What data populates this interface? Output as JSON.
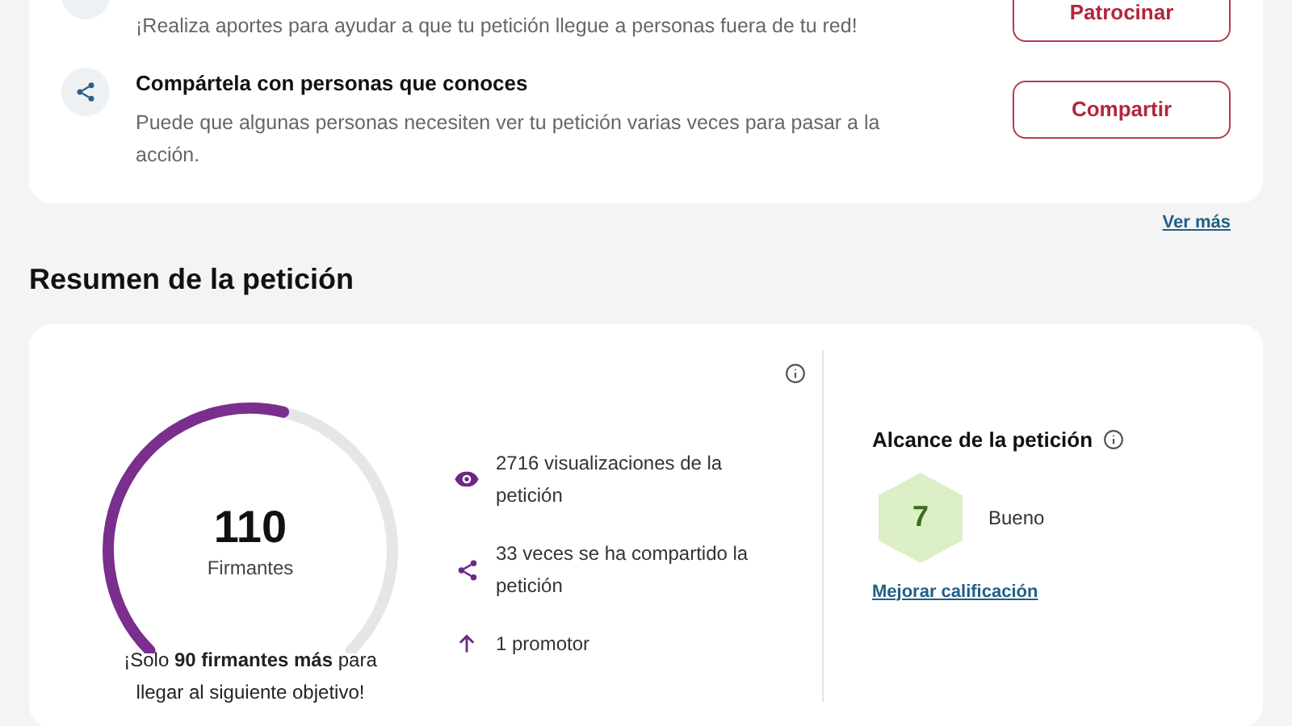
{
  "actions": [
    {
      "kind": "sponsor",
      "description": "¡Realiza aportes para ayudar a que tu petición llegue a personas fuera de tu red!",
      "button": "Patrocinar"
    },
    {
      "kind": "share",
      "title": "Compártela con personas que conoces",
      "description": "Puede que algunas personas necesiten ver tu petición varias veces para pasar a la acción.",
      "button": "Compartir"
    }
  ],
  "see_more": "Ver más",
  "summary": {
    "heading": "Resumen de la petición",
    "gauge": {
      "count": "110",
      "label": "Firmantes"
    },
    "goal_note": "¡Solo **90 firmantes más** para llegar al siguiente objetivo!",
    "stats": [
      {
        "kind": "views",
        "text": "2716 visualizaciones de la petición"
      },
      {
        "kind": "shares",
        "text": "33 veces se ha compartido la petición"
      },
      {
        "kind": "promoters",
        "text": "1 promotor"
      }
    ],
    "reach": {
      "title": "Alcance de la petición",
      "score": "7",
      "rating": "Bueno",
      "link": "Mejorar calificación"
    }
  }
}
